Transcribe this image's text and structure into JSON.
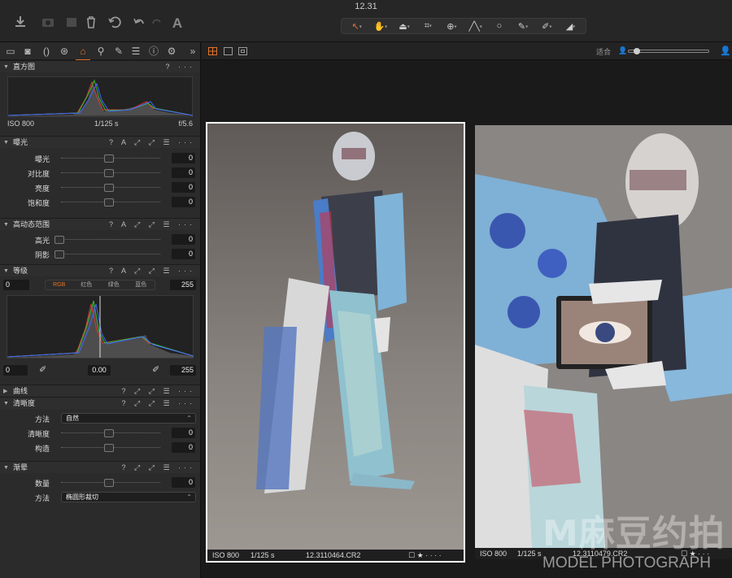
{
  "window": {
    "title": "12.31"
  },
  "toolbar": {
    "left_icons": [
      "import-icon",
      "camera-icon",
      "capture-icon",
      "trash-icon",
      "undo-history-icon",
      "undo-icon",
      "redo-icon",
      "text-icon"
    ],
    "cursor_tools": [
      "select-tool-icon",
      "pan-tool-icon",
      "keystone-tool-icon",
      "crop-tool-icon",
      "rotate-tool-icon",
      "straighten-tool-icon",
      "spot-tool-icon",
      "brush-tool-icon",
      "picker-tool-icon",
      "eraser-tool-icon"
    ]
  },
  "tool_tabs": [
    "folder-icon",
    "camera-icon",
    "lens-icon",
    "color-icon",
    "exposure-icon",
    "search-icon",
    "brush-icon",
    "details-icon",
    "info-icon",
    "gear-icon",
    "more-icon"
  ],
  "histogram": {
    "title": "直方图",
    "iso": "ISO 800",
    "shutter": "1/125 s",
    "aperture": "f/5.6"
  },
  "exposure": {
    "title": "曝光",
    "controls": "? A ⤢ ⤢ ☰ ···",
    "rows": [
      {
        "label": "曝光",
        "value": "0"
      },
      {
        "label": "对比度",
        "value": "0"
      },
      {
        "label": "亮度",
        "value": "0"
      },
      {
        "label": "饱和度",
        "value": "0"
      }
    ]
  },
  "hdr": {
    "title": "高动态范围",
    "rows": [
      {
        "label": "高光",
        "value": "0"
      },
      {
        "label": "阴影",
        "value": "0"
      }
    ]
  },
  "levels": {
    "title": "等级",
    "input_low": "0",
    "input_high": "255",
    "channels": [
      "RGB",
      "红色",
      "绿色",
      "蓝色"
    ],
    "output_low": "0",
    "midpoint": "0.00",
    "output_high": "255"
  },
  "curves": {
    "title": "曲线"
  },
  "clarity": {
    "title": "清晰度",
    "method_label": "方法",
    "method_value": "自然",
    "rows": [
      {
        "label": "清晰度",
        "value": "0"
      },
      {
        "label": "构造",
        "value": "0"
      }
    ]
  },
  "vignetting": {
    "title": "渐晕",
    "amount_label": "数量",
    "amount_value": "0",
    "method_label": "方法",
    "method_value": "椭圆形裁切"
  },
  "viewer": {
    "fit_label": "适合",
    "photos": [
      {
        "iso": "ISO 800",
        "shutter": "1/125 s",
        "filename": "12.3110464.CR2",
        "rating": "☐ ★ · · · ·"
      },
      {
        "iso": "ISO 800",
        "shutter": "1/125 s",
        "filename": "12.3110479.CR2",
        "rating": "☐ ★ · · ·"
      }
    ]
  },
  "watermark": {
    "logo": "M麻豆约拍",
    "text": "MODEL PHOTOGRAPH"
  }
}
